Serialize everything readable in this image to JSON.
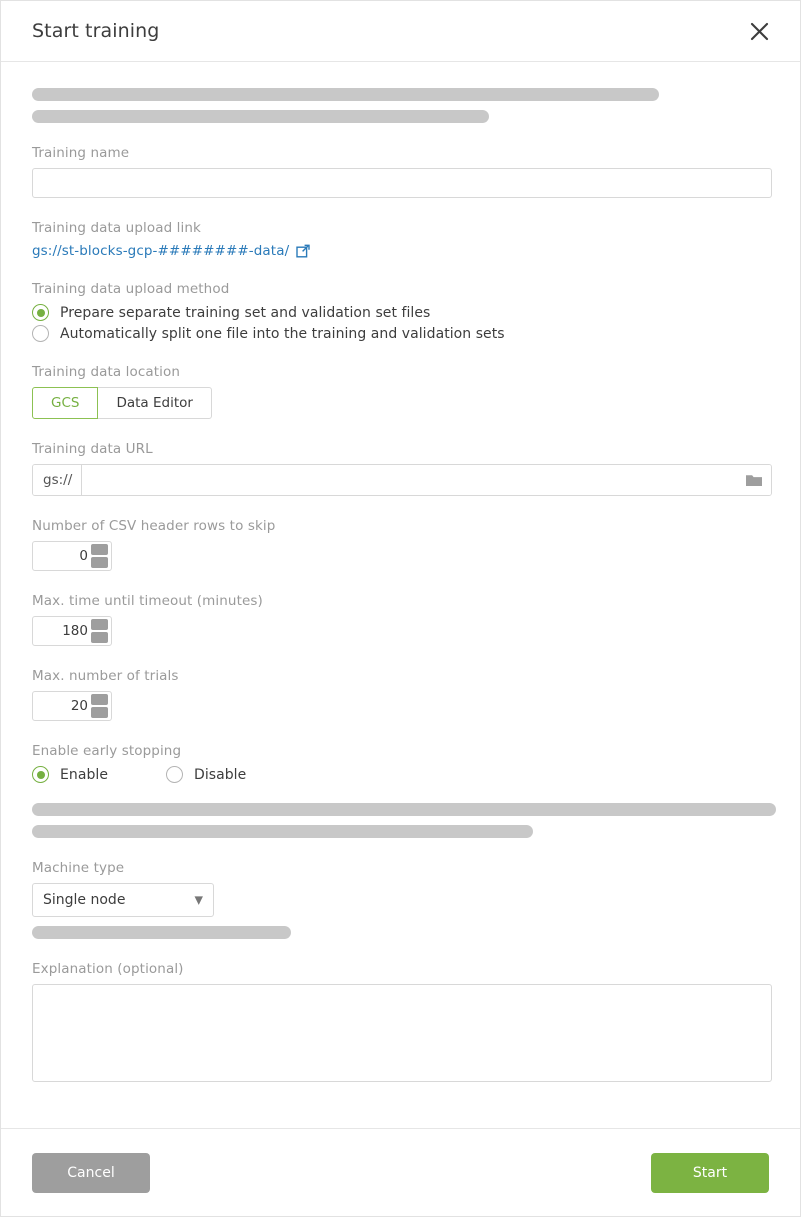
{
  "dialog": {
    "title": "Start training",
    "close_icon": "close-icon"
  },
  "placeholders": {
    "top_bar_1_width": 627,
    "top_bar_2_width": 457,
    "mid_bar_1_width": 744,
    "mid_bar_2_width": 501,
    "machine_bar_width": 259
  },
  "fields": {
    "training_name": {
      "label": "Training name",
      "value": "",
      "placeholder": ""
    },
    "upload_link": {
      "label": "Training data upload link",
      "url_text": "gs://st-blocks-gcp-########-data/",
      "external_icon": "external-link-icon"
    },
    "upload_method": {
      "label": "Training data upload method",
      "options": [
        {
          "label": "Prepare separate training set and validation set files",
          "checked": true
        },
        {
          "label": "Automatically split one file into the training and validation sets",
          "checked": false
        }
      ]
    },
    "data_location": {
      "label": "Training data location",
      "options": [
        {
          "label": "GCS",
          "active": true
        },
        {
          "label": "Data Editor",
          "active": false
        }
      ]
    },
    "data_url": {
      "label": "Training data URL",
      "prefix": "gs://",
      "value": "",
      "placeholder": "",
      "browse_icon": "folder-icon"
    },
    "csv_skip": {
      "label": "Number of CSV header rows to skip",
      "value": "0"
    },
    "timeout": {
      "label": "Max. time until timeout (minutes)",
      "value": "180"
    },
    "max_trials": {
      "label": "Max. number of trials",
      "value": "20"
    },
    "early_stopping": {
      "label": "Enable early stopping",
      "options": [
        {
          "label": "Enable",
          "checked": true
        },
        {
          "label": "Disable",
          "checked": false
        }
      ]
    },
    "machine_type": {
      "label": "Machine type",
      "selected": "Single node",
      "options": [
        "Single node"
      ],
      "caret_icon": "chevron-down-icon"
    },
    "explanation": {
      "label": "Explanation (optional)",
      "value": "",
      "placeholder": ""
    }
  },
  "footer": {
    "cancel_label": "Cancel",
    "start_label": "Start"
  },
  "colors": {
    "accent_green": "#7cb342",
    "link_blue": "#2a7ab9",
    "cancel_gray": "#9e9e9e",
    "skeleton_gray": "#c8c8c8"
  }
}
